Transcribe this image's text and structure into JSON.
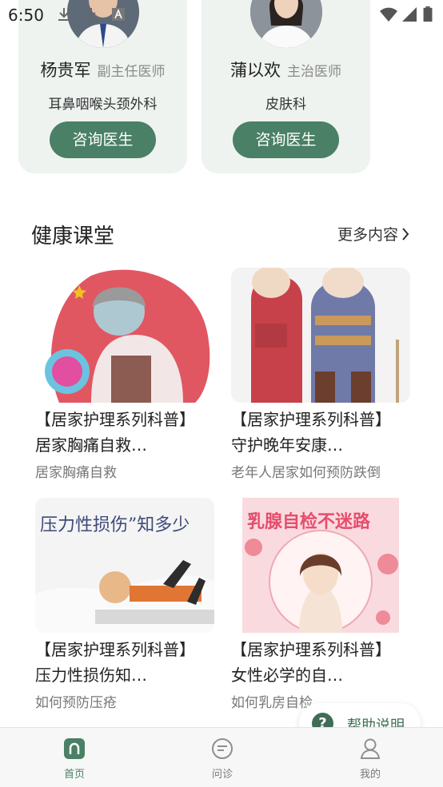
{
  "status_bar": {
    "time": "6:50"
  },
  "doctors": [
    {
      "name": "杨贵军",
      "title": "副主任医师",
      "department": "耳鼻咽喉头颈外科",
      "button": "咨询医生"
    },
    {
      "name": "蒲以欢",
      "title": "主治医师",
      "department": "皮肤科",
      "button": "咨询医生"
    }
  ],
  "health_class": {
    "title": "健康课堂",
    "more": "更多内容",
    "articles": [
      {
        "title": "【居家护理系列科普】 居家胸痛自救…",
        "subtitle": "居家胸痛自救"
      },
      {
        "title": "【居家护理系列科普】 守护晚年安康…",
        "subtitle": "老年人居家如何预防跌倒"
      },
      {
        "title": "【居家护理系列科普】 压力性损伤知…",
        "subtitle": "如何预防压疮",
        "image_text": "压力性损伤”知多少"
      },
      {
        "title": "【居家护理系列科普】 女性必学的自…",
        "subtitle": "如何乳房自检",
        "image_text": "乳腺自检不迷路"
      }
    ]
  },
  "help": {
    "label": "帮助说明"
  },
  "bottom_nav": [
    {
      "label": "首页",
      "icon": "home-icon",
      "active": true
    },
    {
      "label": "问诊",
      "icon": "chat-icon",
      "active": false
    },
    {
      "label": "我的",
      "icon": "user-icon",
      "active": false
    }
  ],
  "colors": {
    "accent": "#4a8065",
    "card_bg": "#eef3f0"
  }
}
